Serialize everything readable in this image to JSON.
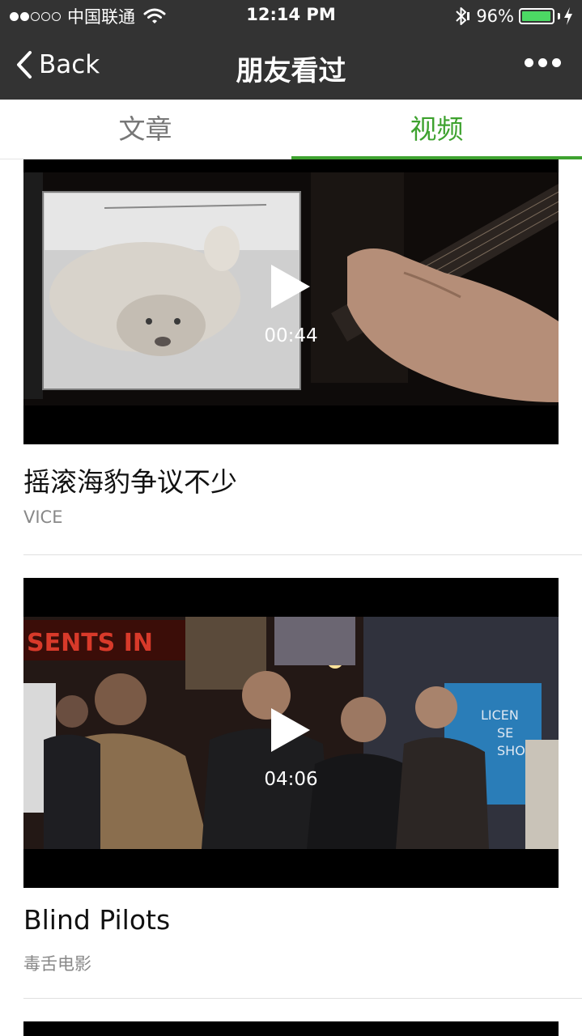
{
  "status_bar": {
    "carrier": "中国联通",
    "time": "12:14 PM",
    "battery_percent": "96%",
    "battery_level": 0.96,
    "battery_color": "#4cd964"
  },
  "nav": {
    "back_label": "Back",
    "title": "朋友看过",
    "more_icon": "more-dots-icon"
  },
  "tabs": [
    {
      "label": "文章",
      "active": false
    },
    {
      "label": "视频",
      "active": true
    }
  ],
  "accent_color": "#3ea22f",
  "videos": [
    {
      "duration": "00:44",
      "title": "摇滚海豹争议不少",
      "source": "VICE"
    },
    {
      "duration": "04:06",
      "title": "Blind Pilots",
      "source": "毒舌电影"
    }
  ]
}
